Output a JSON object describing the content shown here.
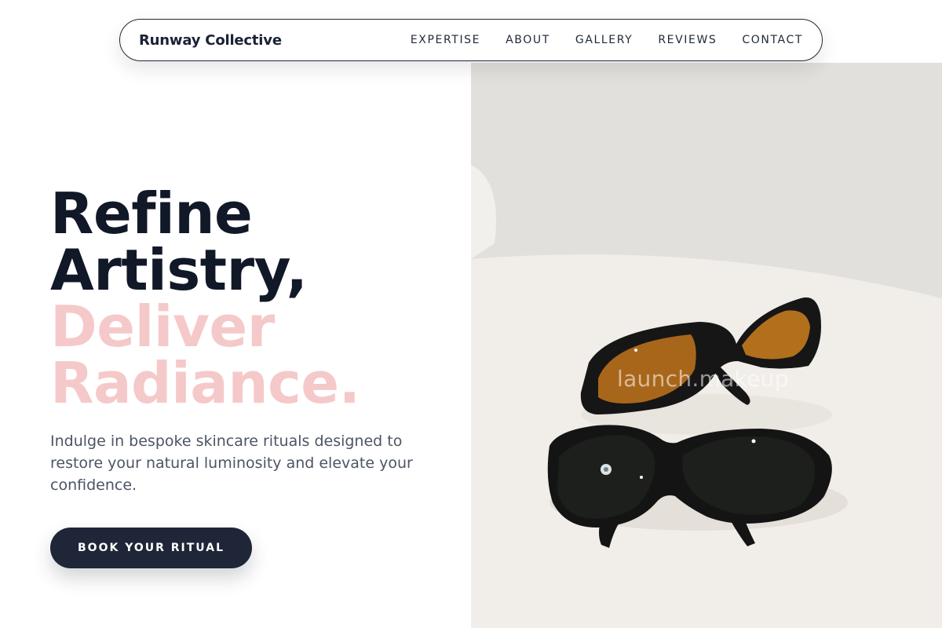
{
  "nav": {
    "brand": "Runway Collective",
    "links": [
      "EXPERTISE",
      "ABOUT",
      "GALLERY",
      "REVIEWS",
      "CONTACT"
    ]
  },
  "hero": {
    "headline_dark": [
      "Refine",
      "Artistry,"
    ],
    "headline_accent": [
      "Deliver",
      "Radiance."
    ],
    "subtext": "Indulge in bespoke skincare rituals designed to restore your natural luminosity and elevate your confidence.",
    "cta_label": "BOOK YOUR RITUAL",
    "image_watermark": "launch.makeup"
  },
  "colors": {
    "primary_dark": "#1e2638",
    "accent_pink": "#f5c9c9",
    "body_text": "#4b5563"
  },
  "icons": {
    "hero_image": "protective-eyewear-photo"
  }
}
